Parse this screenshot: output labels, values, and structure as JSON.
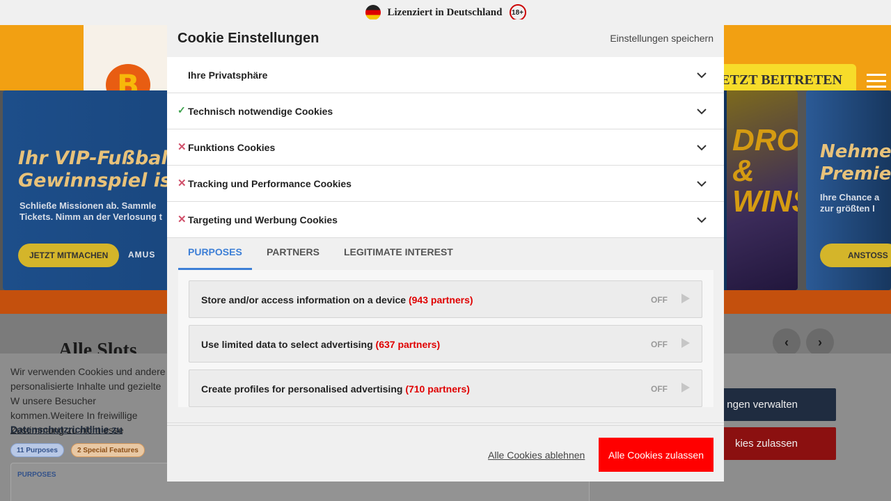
{
  "topbar": {
    "license_text": "Lizenziert in Deutschland",
    "age": "18+"
  },
  "header": {
    "logo_letter": "B",
    "join_label": "JETZT BEITRETEN"
  },
  "banners": {
    "left_title_1": "Ihr VIP-Fußball-",
    "left_title_2": "Gewinnspiel ist",
    "left_sub": "Schließe Missionen ab. Sammle Tickets. Nimm an der Verlosung t",
    "left_cta": "JETZT MITMACHEN",
    "left_brand": "AMUS",
    "game_text": "DROPS & WINS",
    "right_title_1": "Nehmen",
    "right_title_2": "Premie",
    "right_sub_1": "Ihre Chance a",
    "right_sub_2": "zur größten I",
    "right_cta": "ANSTOSS"
  },
  "section": {
    "title": "Alle Slots",
    "prev": "‹",
    "next": "›"
  },
  "consent_bar": {
    "text": "Wir verwenden Cookies und andere personalisierte Inhalte und gezielte W unsere Besucher kommen.Weitere In freiwillige Zustimmung zu nicht esse",
    "privacy_link": "Datenschutzrichtlinie zu",
    "chip_purposes": "11 Purposes",
    "chip_special": "2 Special Features",
    "purposes_title": "PURPOSES",
    "manage_btn": "ngen verwalten",
    "allow_btn": "kies zulassen"
  },
  "modal": {
    "title": "Cookie Einstellungen",
    "save_settings": "Einstellungen speichern",
    "accordion": [
      {
        "label": "Ihre Privatsphäre",
        "status": "none"
      },
      {
        "label": "Technisch notwendige Cookies",
        "status": "enabled"
      },
      {
        "label": "Funktions Cookies",
        "status": "disabled"
      },
      {
        "label": "Tracking und Performance Cookies",
        "status": "disabled"
      },
      {
        "label": "Targeting und Werbung Cookies",
        "status": "disabled"
      }
    ],
    "tabs": {
      "purposes": "PURPOSES",
      "partners": "PARTNERS",
      "legit": "LEGITIMATE INTEREST",
      "active": "purposes"
    },
    "purposes": [
      {
        "name": "Store and/or access information on a device",
        "count": "(943 partners)",
        "state": "OFF"
      },
      {
        "name": "Use limited data to select advertising",
        "count": "(637 partners)",
        "state": "OFF"
      },
      {
        "name": "Create profiles for personalised advertising",
        "count": "(710 partners)",
        "state": "OFF"
      }
    ],
    "footer": {
      "reject": "Alle Cookies ablehnen",
      "accept": "Alle Cookies zulassen"
    }
  },
  "colors": {
    "accent": "#3d7fd6",
    "accept": "#ff0000",
    "partner_count": "#e00000",
    "enabled": "#3aa14a",
    "disabled": "#d0506a"
  },
  "icons": {
    "enabled": "check-icon",
    "disabled": "cross-icon",
    "expand": "chevron-down-icon",
    "toggle": "play-icon"
  }
}
